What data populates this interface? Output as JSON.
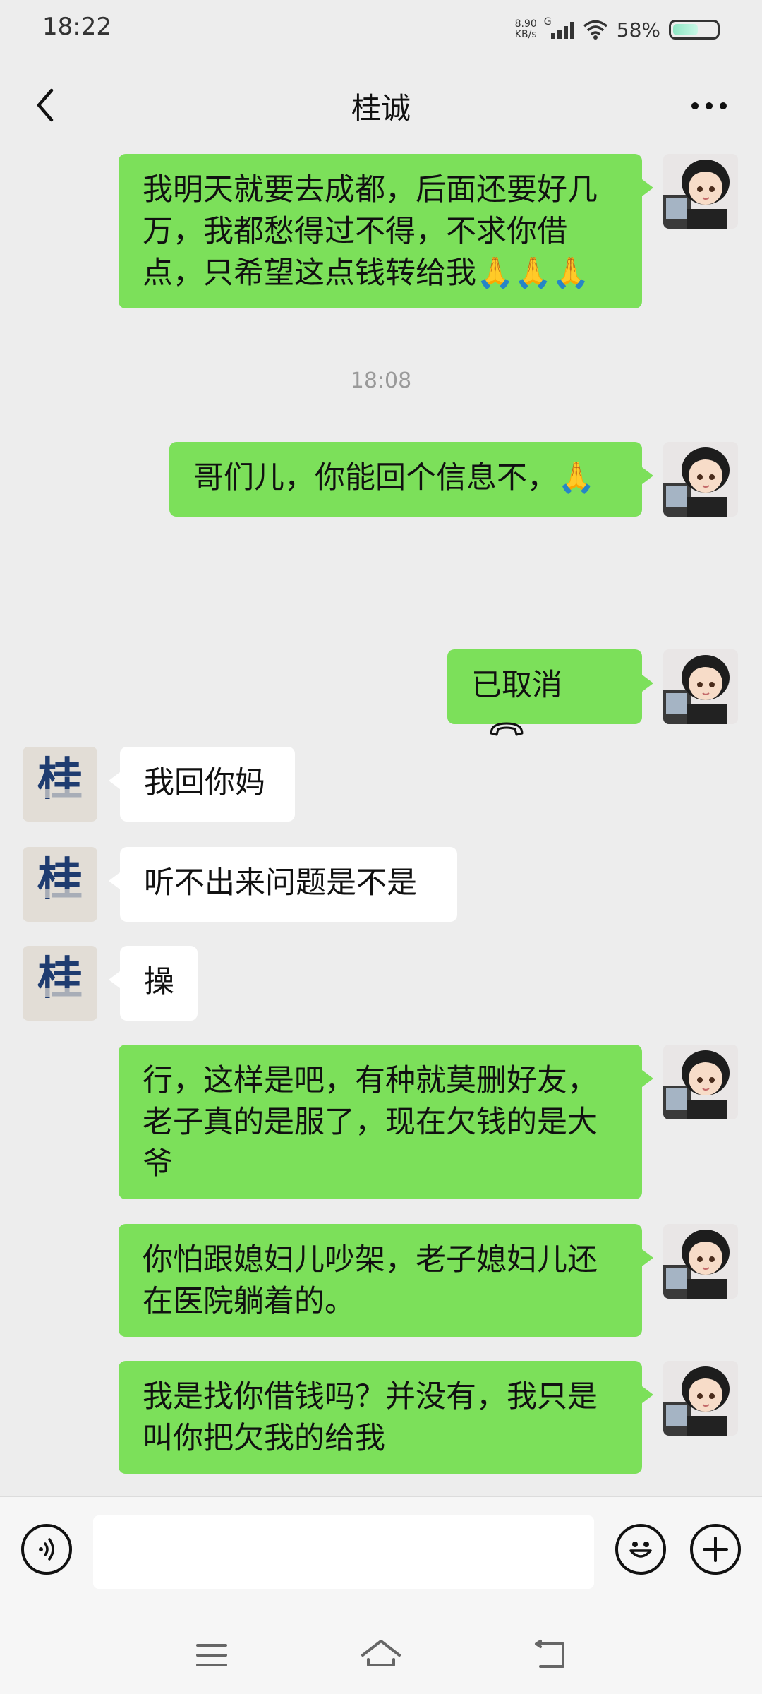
{
  "status_bar": {
    "time": "18:22",
    "net_speed_value": "8.90",
    "net_speed_unit": "KB/s",
    "network_type": "G",
    "battery_text": "58%",
    "battery_level": 0.58,
    "battery_color": "#8ee6c4"
  },
  "header": {
    "title": "桂诚",
    "back_icon": "chevron-left-icon",
    "more_icon": "more-dots-icon"
  },
  "colors": {
    "outgoing_bubble": "#7ce05a",
    "incoming_bubble": "#ffffff",
    "background": "#ededed"
  },
  "messages": [
    {
      "dir": "out",
      "text": "我明天就要去成都，后面还要好几万，我都愁得过不得，不求你借点，只希望这点钱转给我🙏🙏🙏",
      "lines": [
        "我明天就要去成都，后面还要好几",
        "万，我都愁得过不得，不求你借",
        "点，只希望这点钱转给我🙏🙏🙏"
      ]
    },
    {
      "type": "time",
      "text": "18:08"
    },
    {
      "dir": "out",
      "text": "哥们儿，你能回个信息不，🙏"
    },
    {
      "dir": "out",
      "text": "已取消",
      "icon": "phone-hangup-icon"
    },
    {
      "dir": "in",
      "text": "我回你妈"
    },
    {
      "dir": "in",
      "text": "听不出来问题是不是"
    },
    {
      "dir": "in",
      "text": "操"
    },
    {
      "dir": "out",
      "lines": [
        "行，这样是吧，有种就莫删好友，",
        "老子真的是服了，现在欠钱的是大",
        "爷"
      ]
    },
    {
      "dir": "out",
      "lines": [
        "你怕跟媳妇儿吵架，老子媳妇儿还",
        "在医院躺着的。"
      ]
    },
    {
      "dir": "out",
      "lines": [
        "我是找你借钱吗？并没有，我只是",
        "叫你把欠我的给我"
      ]
    }
  ],
  "contact_avatar_text": "桂",
  "input_bar": {
    "voice_icon": "voice-icon",
    "emoji_icon": "emoji-icon",
    "plus_icon": "plus-icon",
    "input_value": ""
  },
  "nav_bar": {
    "menu_icon": "menu-icon",
    "home_icon": "home-icon",
    "back_icon": "back-arrow-icon"
  }
}
